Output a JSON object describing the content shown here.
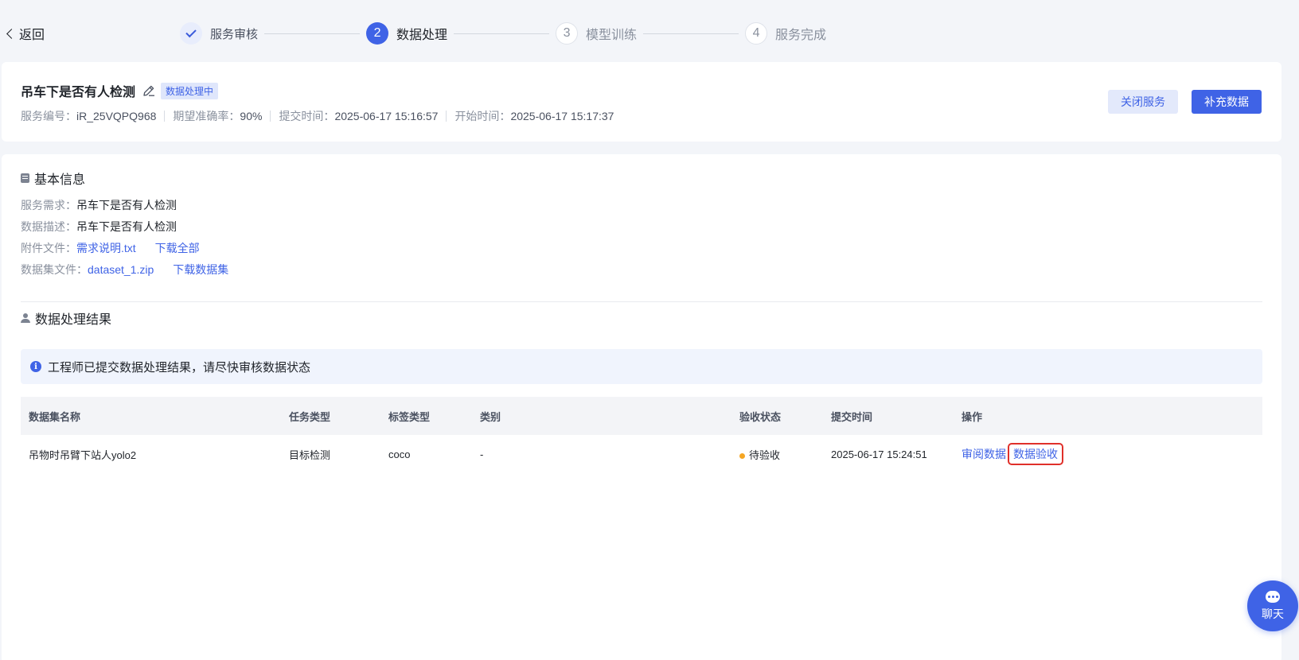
{
  "nav": {
    "back_label": "返回"
  },
  "steps": [
    {
      "index": "",
      "label": "服务审核",
      "state": "done"
    },
    {
      "index": "2",
      "label": "数据处理",
      "state": "active"
    },
    {
      "index": "3",
      "label": "模型训练",
      "state": "pending"
    },
    {
      "index": "4",
      "label": "服务完成",
      "state": "pending"
    }
  ],
  "header": {
    "title": "吊车下是否有人检测",
    "status_tag": "数据处理中",
    "meta": [
      {
        "key": "服务编号：",
        "value": "iR_25VQPQ968"
      },
      {
        "key": "期望准确率：",
        "value": "90%"
      },
      {
        "key": "提交时间：",
        "value": "2025-06-17 15:16:57"
      },
      {
        "key": "开始时间：",
        "value": "2025-06-17 15:17:37"
      }
    ],
    "close_button": "关闭服务",
    "add_button": "补充数据"
  },
  "basic_info": {
    "title": "基本信息",
    "service_req_key": "服务需求：",
    "service_req_value": "吊车下是否有人检测",
    "data_desc_key": "数据描述：",
    "data_desc_value": "吊车下是否有人检测",
    "attachment_key": "附件文件：",
    "attachment_file": "需求说明.txt",
    "attachment_download": "下载全部",
    "dataset_key": "数据集文件：",
    "dataset_file": "dataset_1.zip",
    "dataset_download": "下载数据集"
  },
  "result": {
    "title": "数据处理结果",
    "alert": "工程师已提交数据处理结果，请尽快审核数据状态",
    "columns": [
      "数据集名称",
      "任务类型",
      "标签类型",
      "类别",
      "验收状态",
      "提交时间",
      "操作"
    ],
    "rows": [
      {
        "name": "吊物时吊臂下站人yolo2",
        "task_type": "目标检测",
        "label_type": "coco",
        "category": "-",
        "status": "待验收",
        "submitted": "2025-06-17 15:24:51",
        "action_review": "审阅数据",
        "action_accept": "数据验收"
      }
    ]
  },
  "chat": {
    "label": "聊天"
  },
  "colors": {
    "primary": "#3f63e6",
    "pending": "#f5a623",
    "highlight": "#e0302a"
  }
}
